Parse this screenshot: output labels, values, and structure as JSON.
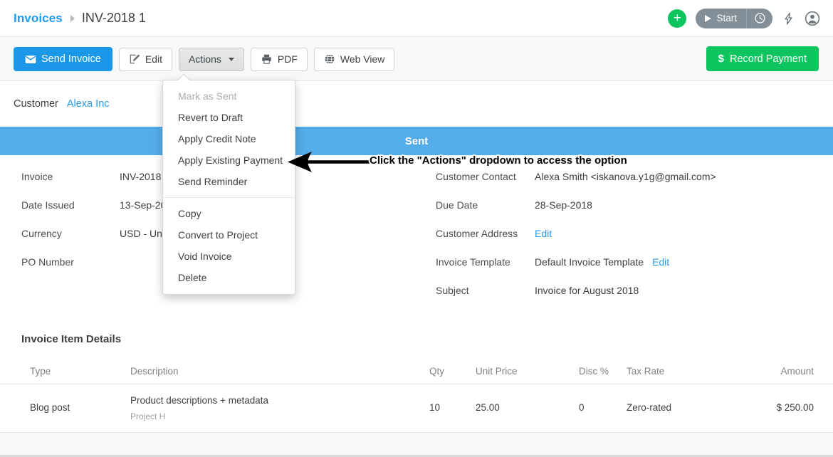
{
  "header": {
    "breadcrumb_root": "Invoices",
    "breadcrumb_current": "INV-2018 1",
    "add_label": "+",
    "timer_start_label": "Start"
  },
  "toolbar": {
    "send_invoice_label": "Send Invoice",
    "edit_label": "Edit",
    "actions_label": "Actions",
    "pdf_label": "PDF",
    "web_view_label": "Web View",
    "record_payment_label": "Record Payment",
    "record_payment_currency": "$"
  },
  "customer": {
    "label": "Customer",
    "name": "Alexa Inc"
  },
  "status": {
    "label": "Sent",
    "color": "#54ace8"
  },
  "details": {
    "left": [
      {
        "label": "Invoice",
        "value": "INV-2018 1"
      },
      {
        "label": "Date Issued",
        "value": "13-Sep-2018"
      },
      {
        "label": "Currency",
        "value": "USD - United States Dollar"
      },
      {
        "label": "PO Number",
        "value": ""
      }
    ],
    "right": [
      {
        "label": "Customer Contact",
        "value": "Alexa Smith <iskanova.y1g@gmail.com>"
      },
      {
        "label": "Due Date",
        "value": "28-Sep-2018"
      },
      {
        "label": "Customer Address",
        "value": "",
        "link": "Edit"
      },
      {
        "label": "Invoice Template",
        "value": "Default Invoice Template",
        "link": "Edit"
      },
      {
        "label": "Subject",
        "value": "Invoice for August 2018"
      }
    ]
  },
  "items": {
    "title": "Invoice Item Details",
    "columns": {
      "type": "Type",
      "description": "Description",
      "qty": "Qty",
      "unit_price": "Unit Price",
      "disc": "Disc %",
      "tax_rate": "Tax Rate",
      "amount": "Amount"
    },
    "rows": [
      {
        "type": "Blog post",
        "description": "Product descriptions + metadata",
        "description_sub": "Project H",
        "qty": "10",
        "unit_price": "25.00",
        "disc": "0",
        "tax_rate": "Zero-rated",
        "amount": "$ 250.00"
      }
    ]
  },
  "dropdown": {
    "items": [
      {
        "label": "Mark as Sent",
        "disabled": true
      },
      {
        "label": "Revert to Draft",
        "disabled": false
      },
      {
        "label": "Apply Credit Note",
        "disabled": false
      },
      {
        "label": "Apply Existing Payment",
        "disabled": false
      },
      {
        "label": "Send Reminder",
        "disabled": false
      }
    ],
    "items2": [
      {
        "label": "Copy",
        "disabled": false
      },
      {
        "label": "Convert to Project",
        "disabled": false
      },
      {
        "label": "Void Invoice",
        "disabled": false
      },
      {
        "label": "Delete",
        "disabled": false
      }
    ]
  },
  "annotation": {
    "text": "Click the \"Actions\" dropdown to access the option"
  }
}
